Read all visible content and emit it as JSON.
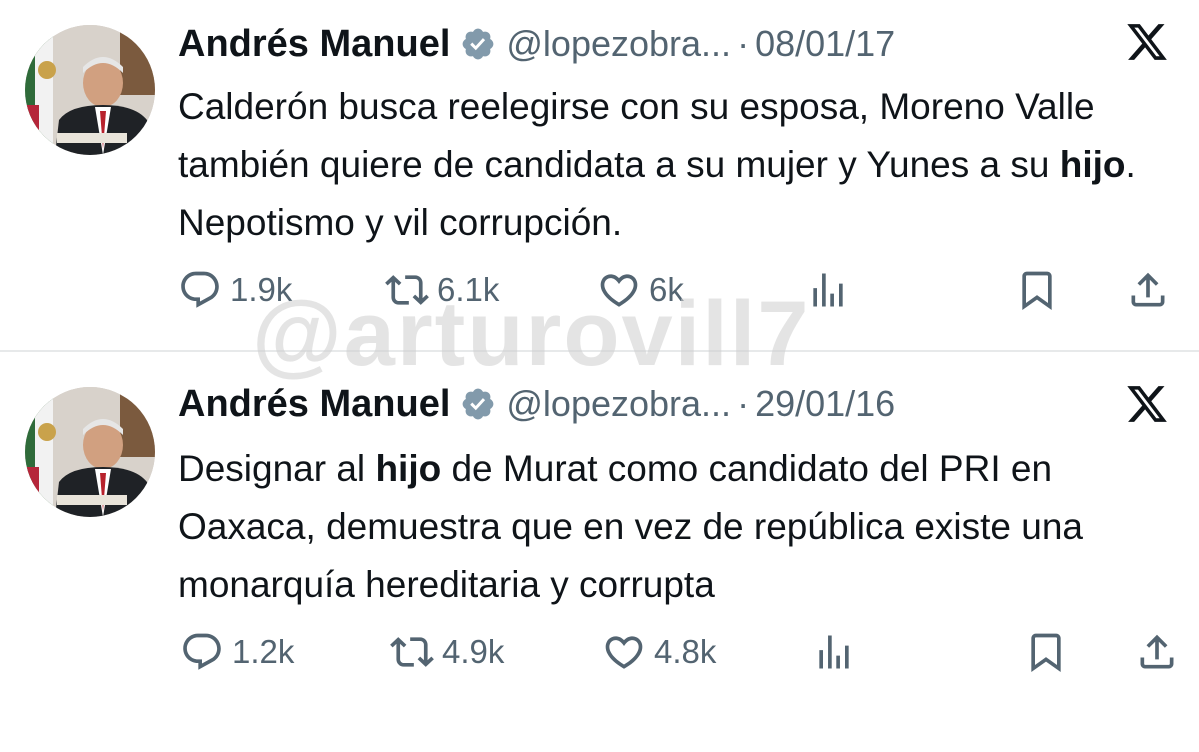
{
  "tweets": [
    {
      "author_name": "Andrés Manuel",
      "handle": "@lopezobra...",
      "separator": "·",
      "date": "08/01/17",
      "text_parts": [
        {
          "t": "Calderón busca reelegirse con su esposa, Moreno Valle también quiere de candidata a su mujer y Yunes a su "
        },
        {
          "t": "hijo"
        },
        {
          "t": ". Nepotismo y vil corrupción."
        }
      ],
      "replies": "1.9k",
      "reposts": "6.1k",
      "likes": "6k"
    },
    {
      "author_name": "Andrés Manuel",
      "handle": "@lopezobra...",
      "separator": "·",
      "date": "29/01/16",
      "text_parts": [
        {
          "t": "Designar al "
        },
        {
          "t": "hijo"
        },
        {
          "t": " de Murat como candidato del PRI en Oaxaca, demuestra que en vez de república existe una monarquía hereditaria y corrupta"
        }
      ],
      "replies": "1.2k",
      "reposts": "4.9k",
      "likes": "4.8k"
    }
  ],
  "watermark": "@arturovill7",
  "icons": {
    "verified": "verified-badge-icon",
    "brand": "x-logo-icon",
    "reply": "reply-icon",
    "repost": "repost-icon",
    "like": "heart-icon",
    "views": "views-icon",
    "bookmark": "bookmark-icon",
    "share": "share-icon"
  },
  "colors": {
    "text": "#0f1419",
    "secondary": "#536471",
    "verified_badge": "#829aab",
    "divider": "#e7e9ea"
  }
}
